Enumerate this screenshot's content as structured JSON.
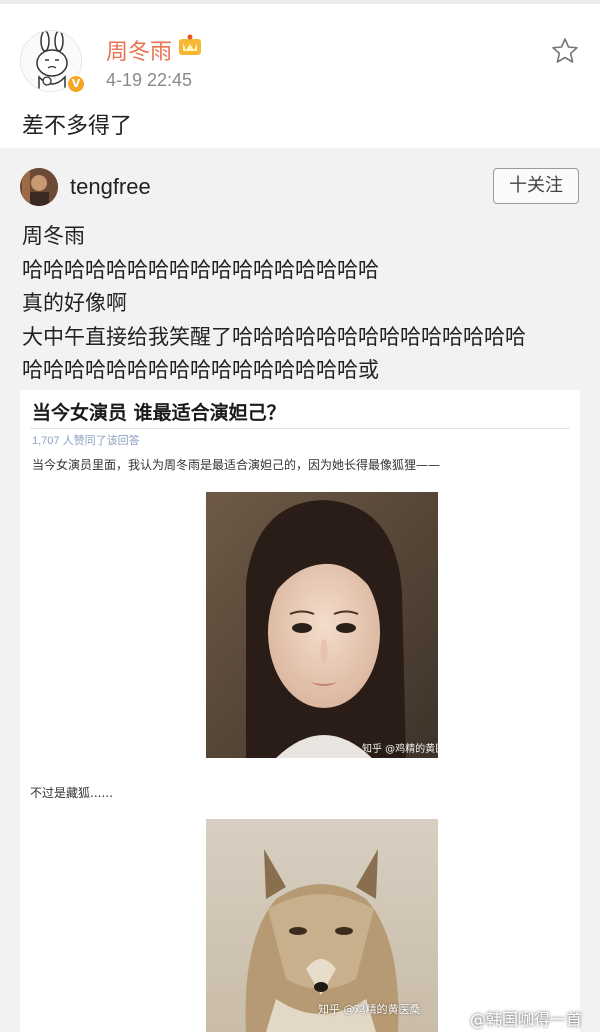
{
  "post": {
    "author": "周冬雨",
    "timestamp": "4-19 22:45",
    "text": "差不多得了"
  },
  "repost": {
    "author": "tengfree",
    "follow_label": "十关注",
    "lines": [
      "周冬雨",
      "哈哈哈哈哈哈哈哈哈哈哈哈哈哈哈哈哈",
      "真的好像啊",
      "大中午直接给我笑醒了哈哈哈哈哈哈哈哈哈哈哈哈哈哈",
      "哈哈哈哈哈哈哈哈哈哈哈哈哈哈哈哈或"
    ]
  },
  "embed": {
    "question_title": "当今女演员 谁最适合演妲己？",
    "likes": "1,707 人赞同了该回答",
    "answer": "当今女演员里面，我认为周冬雨是最适合演妲己的，因为她长得最像狐狸——",
    "photo1_watermark": "知乎 @鸡精的黄医桑",
    "note": "不过是藏狐......",
    "photo2_watermark": "知乎 @鸡精的黄医桑"
  },
  "corner_watermark": "@韩国咖得一首",
  "colors": {
    "author_name": "#eb7350",
    "verified_badge": "#f6a623",
    "repost_bg": "#f2f2f2",
    "likes_text": "#8da2c4"
  },
  "icons": [
    "favorite-star-icon",
    "crown-badge-icon",
    "verified-v-icon"
  ]
}
